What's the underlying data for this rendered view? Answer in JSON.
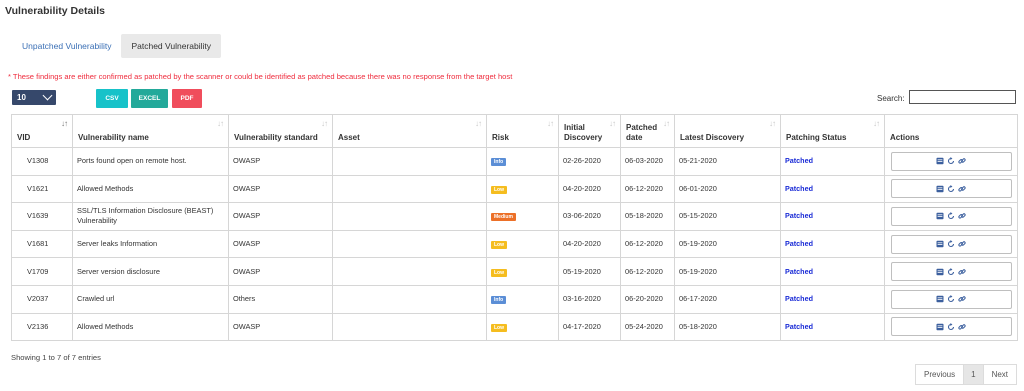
{
  "page": {
    "title": "Vulnerability Details"
  },
  "tabs": [
    {
      "label": "Unpatched Vulnerability",
      "active": false
    },
    {
      "label": "Patched Vulnerability",
      "active": true
    }
  ],
  "notice": "* These findings are either confirmed as patched by the scanner or could be identified as patched because there was no response from the target host",
  "controls": {
    "page_length": "10",
    "export": {
      "csv": "CSV",
      "excel": "EXCEL",
      "pdf": "PDF"
    },
    "search_label": "Search:",
    "search_value": ""
  },
  "table": {
    "columns": [
      "VID",
      "Vulnerability name",
      "Vulnerability standard",
      "Asset",
      "Risk",
      "Initial Discovery",
      "Patched date",
      "Latest Discovery",
      "Patching Status",
      "Actions"
    ],
    "rows": [
      {
        "vid": "V1308",
        "name": "Ports found open on remote host.",
        "standard": "OWASP",
        "asset": "",
        "risk": "Info",
        "initial": "02-26-2020",
        "patched": "06-03-2020",
        "latest": "05-21-2020",
        "status": "Patched"
      },
      {
        "vid": "V1621",
        "name": "Allowed Methods",
        "standard": "OWASP",
        "asset": "",
        "risk": "Low",
        "initial": "04-20-2020",
        "patched": "06-12-2020",
        "latest": "06-01-2020",
        "status": "Patched"
      },
      {
        "vid": "V1639",
        "name": "SSL/TLS Information Disclosure (BEAST) Vulnerability",
        "standard": "OWASP",
        "asset": "",
        "risk": "Medium",
        "initial": "03-06-2020",
        "patched": "05-18-2020",
        "latest": "05-15-2020",
        "status": "Patched"
      },
      {
        "vid": "V1681",
        "name": "Server leaks Information",
        "standard": "OWASP",
        "asset": "",
        "risk": "Low",
        "initial": "04-20-2020",
        "patched": "06-12-2020",
        "latest": "05-19-2020",
        "status": "Patched"
      },
      {
        "vid": "V1709",
        "name": "Server version disclosure",
        "standard": "OWASP",
        "asset": "",
        "risk": "Low",
        "initial": "05-19-2020",
        "patched": "06-12-2020",
        "latest": "05-19-2020",
        "status": "Patched"
      },
      {
        "vid": "V2037",
        "name": "Crawled url",
        "standard": "Others",
        "asset": "",
        "risk": "Info",
        "initial": "03-16-2020",
        "patched": "06-20-2020",
        "latest": "06-17-2020",
        "status": "Patched"
      },
      {
        "vid": "V2136",
        "name": "Allowed Methods",
        "standard": "OWASP",
        "asset": "",
        "risk": "Low",
        "initial": "04-17-2020",
        "patched": "05-24-2020",
        "latest": "05-18-2020",
        "status": "Patched"
      }
    ],
    "action_icons": [
      "details-icon",
      "reopen-icon",
      "link-icon"
    ]
  },
  "footer": {
    "info": "Showing 1 to 7 of 7 entries",
    "pagination": {
      "previous": "Previous",
      "current": "1",
      "next": "Next"
    }
  },
  "colors": {
    "accent_blue": "#3a6fb5",
    "notice_red": "#ef2d3e",
    "status_blue": "#1a2bd6",
    "csv": "#17c2c9",
    "excel": "#23a99a",
    "pdf": "#f04d5c",
    "risk_info": "#5b8ed6",
    "risk_low": "#f5bd1f",
    "risk_medium": "#ec7028"
  }
}
